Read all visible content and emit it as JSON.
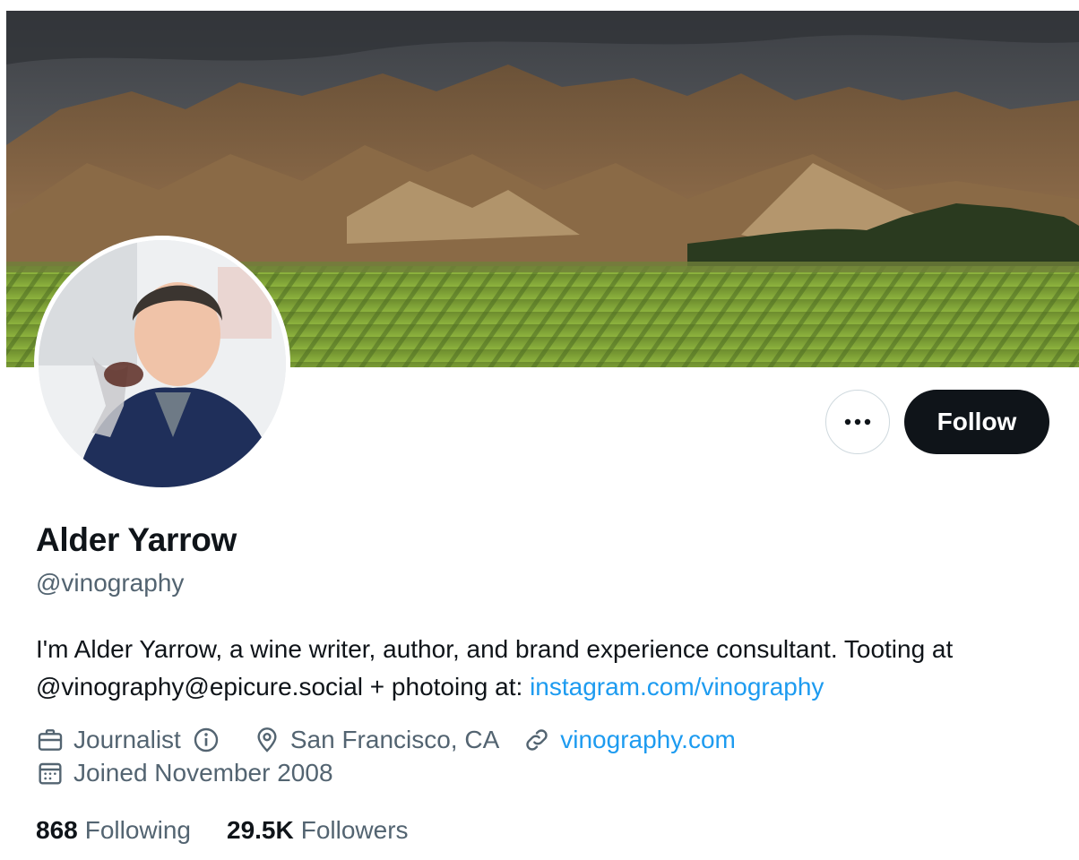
{
  "profile": {
    "display_name": "Alder Yarrow",
    "handle": "@vinography",
    "bio_text": "I'm Alder Yarrow, a wine writer, author, and brand experience consultant. Tooting at @vinography@epicure.social + photoing at: ",
    "bio_link": "instagram.com/vinography",
    "category": "Journalist",
    "location": "San Francisco, CA",
    "website": "vinography.com",
    "joined": "Joined November 2008"
  },
  "actions": {
    "follow_label": "Follow",
    "more_icon": "more-horizontal-icon"
  },
  "stats": {
    "following_count": "868",
    "following_label": "Following",
    "followers_count": "29.5K",
    "followers_label": "Followers"
  },
  "colors": {
    "link": "#1d9bf0",
    "text_primary": "#0f1419",
    "text_secondary": "#536471",
    "follow_bg": "#0f1419"
  }
}
